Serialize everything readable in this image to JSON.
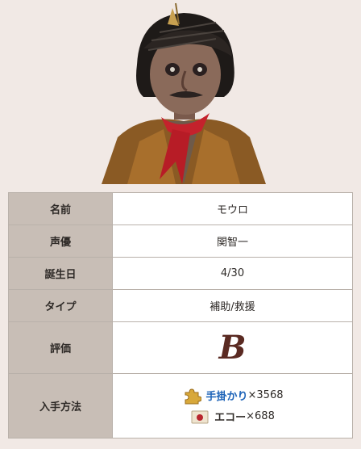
{
  "rows": [
    {
      "label": "名前",
      "value": "モウロ"
    },
    {
      "label": "声優",
      "value": "関智一"
    },
    {
      "label": "誕生日",
      "value": "4/30"
    },
    {
      "label": "タイプ",
      "value": "補助/救援"
    },
    {
      "label": "評価",
      "value": "B"
    },
    {
      "label": "入手方法"
    }
  ],
  "acquire": [
    {
      "icon": "puzzle-piece-icon",
      "name": "手掛かり",
      "count": "×3568"
    },
    {
      "icon": "sealed-letter-icon",
      "name": "エコー",
      "count": "×688"
    }
  ]
}
